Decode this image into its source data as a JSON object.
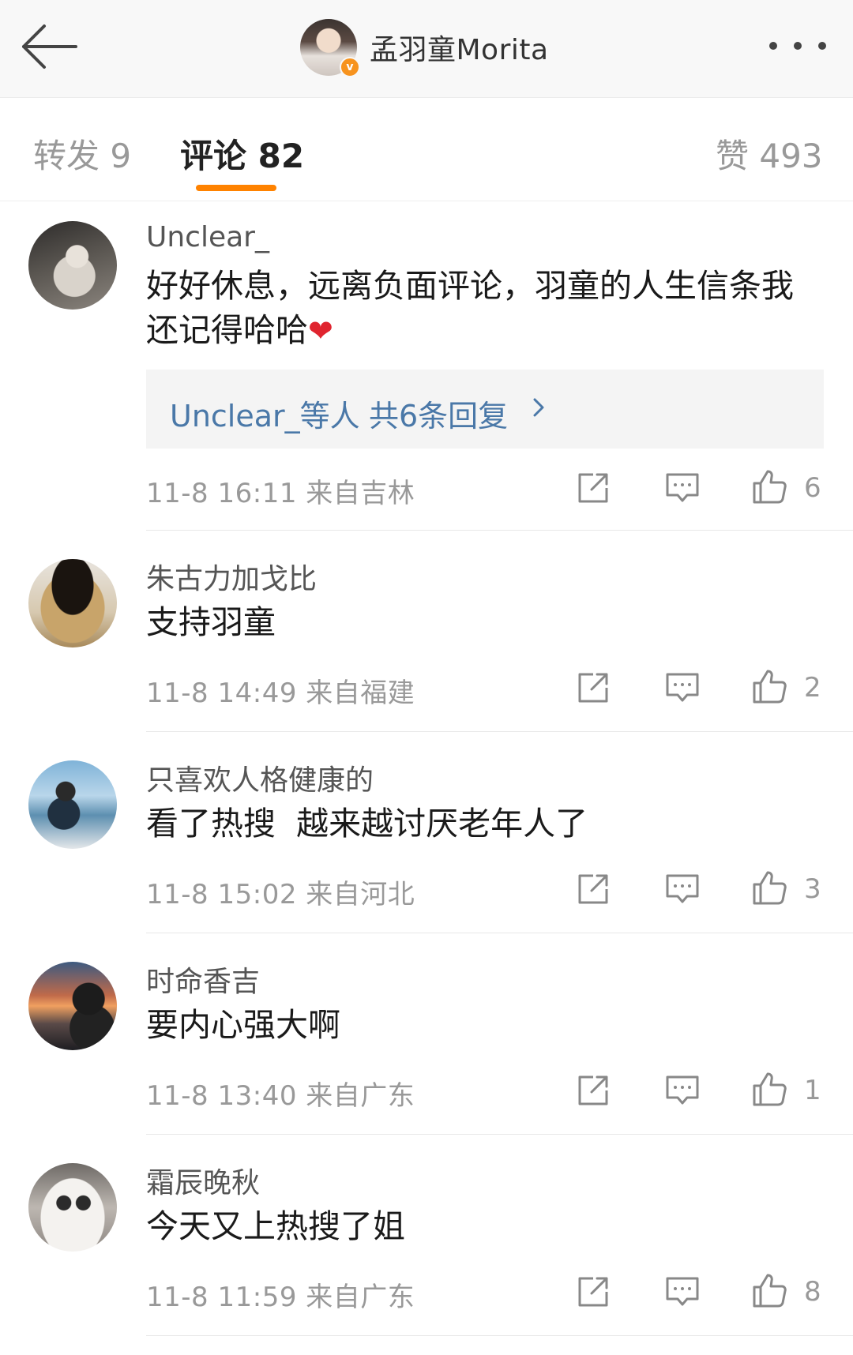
{
  "header": {
    "title": "孟羽童Morita",
    "verified_badge": "v",
    "back_icon": "arrow-left-icon",
    "more_icon": "more-dots-icon"
  },
  "tabs": {
    "repost": "转发 9",
    "comment": "评论 82",
    "like": "赞 493",
    "active": "comment",
    "accent_color": "#ff8200"
  },
  "comments": [
    {
      "user": "Unclear_",
      "text": "好好休息，远离负面评论，羽童的人生信条我还记得哈哈",
      "emoji": "❤",
      "reply": {
        "users": "Unclear_等人",
        "count": "共6条回复"
      },
      "time": "11-8 16:11",
      "location": "来自吉林",
      "likes": "6"
    },
    {
      "user": "朱古力加戈比",
      "text": "支持羽童",
      "time": "11-8 14:49",
      "location": "来自福建",
      "likes": "2"
    },
    {
      "user": "只喜欢人格健康的",
      "text": "看了热搜  越来越讨厌老年人了",
      "time": "11-8 15:02",
      "location": "来自河北",
      "likes": "3"
    },
    {
      "user": "时命香吉",
      "text": "要内心强大啊",
      "time": "11-8 13:40",
      "location": "来自广东",
      "likes": "1"
    },
    {
      "user": "霜辰晚秋",
      "text": "今天又上热搜了姐",
      "time": "11-8 11:59",
      "location": "来自广东",
      "likes": "8"
    }
  ]
}
